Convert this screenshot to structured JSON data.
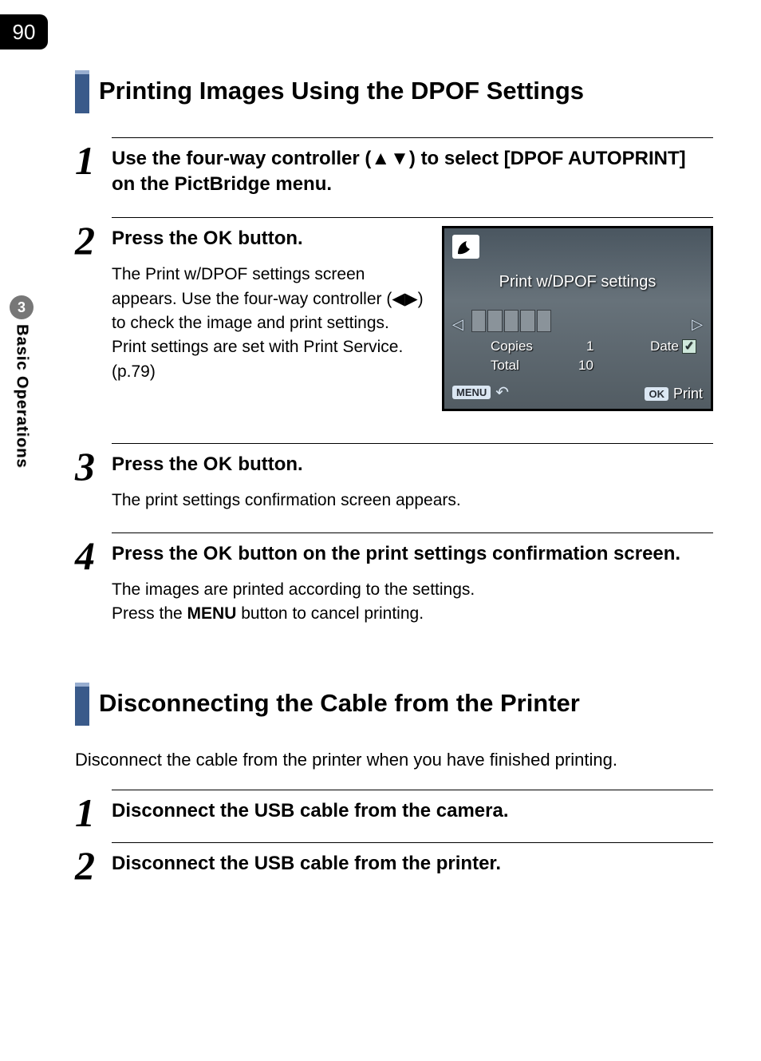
{
  "page_number": "90",
  "side": {
    "chapter_number": "3",
    "label": "Basic Operations"
  },
  "section1": {
    "heading": "Printing Images Using the DPOF Settings",
    "steps": [
      {
        "num": "1",
        "title_pre": "Use the four-way controller (",
        "title_glyph": "▲▼",
        "title_post": ") to select [DPOF AUTOPRINT] on the PictBridge menu."
      },
      {
        "num": "2",
        "title_pre": "Press the ",
        "title_ok": "OK",
        "title_post": " button.",
        "desc_pre": "The Print w/DPOF settings screen appears. Use the four-way controller (",
        "desc_glyph": "◀▶",
        "desc_post": ") to check the image and print settings. Print settings are set with Print Service. (p.79)"
      },
      {
        "num": "3",
        "title_pre": "Press the ",
        "title_ok": "OK",
        "title_post": " button.",
        "desc": "The print settings confirmation screen appears."
      },
      {
        "num": "4",
        "title_pre": "Press the ",
        "title_ok": "OK",
        "title_post": " button on the print settings confirmation screen.",
        "desc_line1": "The images are printed according to the settings.",
        "desc_line2_pre": "Press the ",
        "desc_line2_menu": "MENU",
        "desc_line2_post": " button to cancel printing."
      }
    ]
  },
  "lcd": {
    "title": "Print w/DPOF settings",
    "copies_label": "Copies",
    "copies_value": "1",
    "date_label": "Date",
    "total_label": "Total",
    "total_value": "10",
    "menu_tag": "MENU",
    "ok_tag": "OK",
    "ok_text": "Print"
  },
  "section2": {
    "heading": "Disconnecting the Cable from the Printer",
    "intro": "Disconnect the cable from the printer when you have finished printing.",
    "steps": [
      {
        "num": "1",
        "title": "Disconnect the USB cable from the camera."
      },
      {
        "num": "2",
        "title": "Disconnect the USB cable from the printer."
      }
    ]
  }
}
